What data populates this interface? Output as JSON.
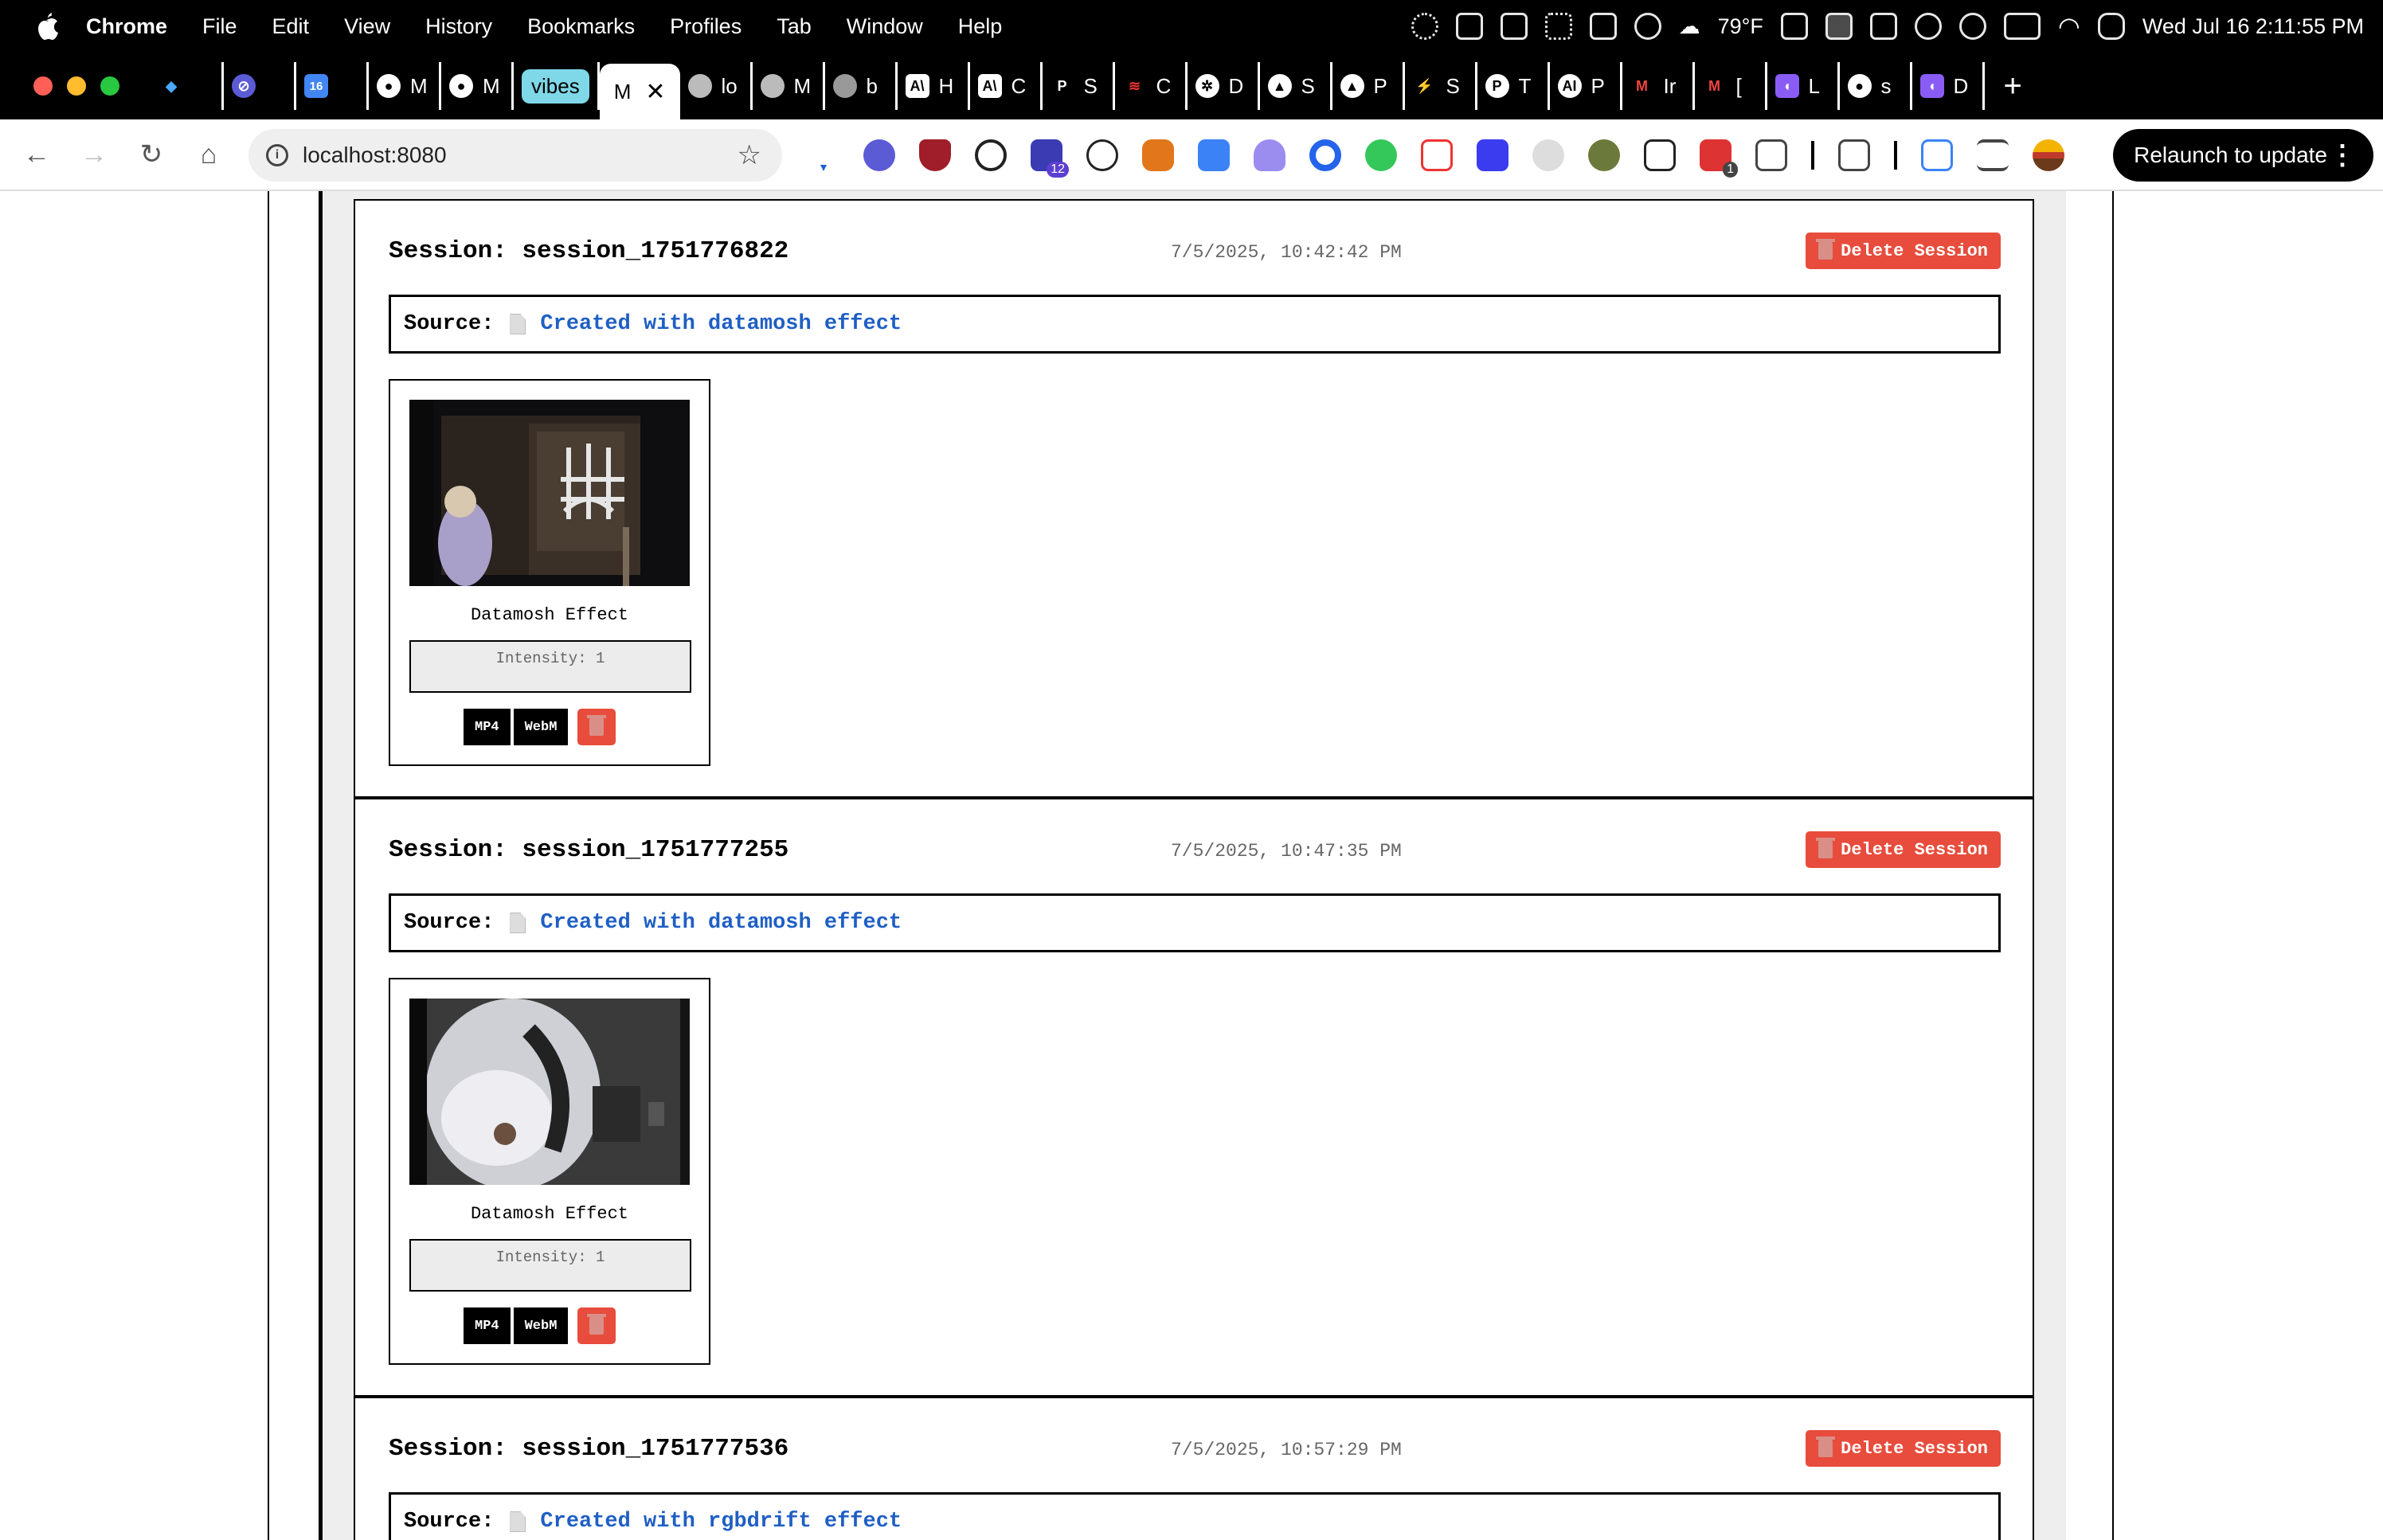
{
  "menubar": {
    "app": "Chrome",
    "items": [
      "File",
      "Edit",
      "View",
      "History",
      "Bookmarks",
      "Profiles",
      "Tab",
      "Window",
      "Help"
    ],
    "weather": "79°F",
    "datetime": "Wed Jul 16  2:11:55 PM"
  },
  "tabs": [
    {
      "label": ""
    },
    {
      "label": ""
    },
    {
      "label": ""
    },
    {
      "label": "M"
    },
    {
      "label": "M"
    },
    {
      "label": "vibes",
      "pill": true
    },
    {
      "label": "M",
      "active": true
    },
    {
      "label": "lo"
    },
    {
      "label": "M"
    },
    {
      "label": "b"
    },
    {
      "label": "H"
    },
    {
      "label": "C"
    },
    {
      "label": "S"
    },
    {
      "label": "C"
    },
    {
      "label": "D"
    },
    {
      "label": "S"
    },
    {
      "label": "P"
    },
    {
      "label": "S"
    },
    {
      "label": "T"
    },
    {
      "label": "P"
    },
    {
      "label": "Ir"
    },
    {
      "label": "["
    },
    {
      "label": "L"
    },
    {
      "label": "s"
    },
    {
      "label": "D"
    }
  ],
  "toolbar": {
    "url": "localhost:8080",
    "relaunch_label": "Relaunch to update",
    "ext_badge_1": "12",
    "ext_badge_2": "1"
  },
  "sessions": [
    {
      "title": "Session: session_1751776822",
      "date": "7/5/2025, 10:42:42 PM",
      "delete_label": "Delete Session",
      "source_label": "Source:",
      "source_text": "Created with datamosh effect",
      "card": {
        "effect": "Datamosh Effect",
        "intensity": "Intensity: 1",
        "mp4": "MP4",
        "webm": "WebM"
      }
    },
    {
      "title": "Session: session_1751777255",
      "date": "7/5/2025, 10:47:35 PM",
      "delete_label": "Delete Session",
      "source_label": "Source:",
      "source_text": "Created with datamosh effect",
      "card": {
        "effect": "Datamosh Effect",
        "intensity": "Intensity: 1",
        "mp4": "MP4",
        "webm": "WebM"
      }
    },
    {
      "title": "Session: session_1751777536",
      "date": "7/5/2025, 10:57:29 PM",
      "delete_label": "Delete Session",
      "source_label": "Source:",
      "source_text": "Created with rgbdrift effect"
    }
  ],
  "colors": {
    "danger": "#e74c3c",
    "link": "#1f5fc4",
    "panel": "#eeeeee"
  }
}
